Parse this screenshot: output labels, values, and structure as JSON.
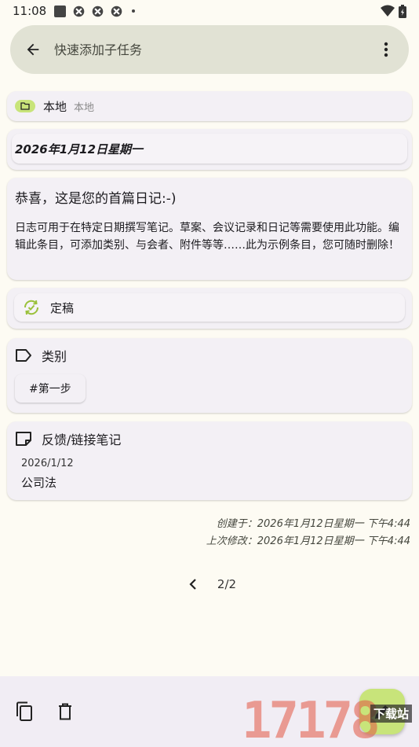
{
  "status_bar": {
    "time": "11:08"
  },
  "search": {
    "placeholder": "快速添加子任务"
  },
  "collection": {
    "name": "本地",
    "subtitle": "本地"
  },
  "entry": {
    "date": "2026年1月12日星期一",
    "title": "恭喜，这是您的首篇日记:-)",
    "description": "日志可用于在特定日期撰写笔记。草案、会议记录和日记等需要使用此功能。编辑此条目，可添加类别、与会者、附件等等……此为示例条目，您可随时删除！"
  },
  "status": {
    "label": "定稿"
  },
  "categories": {
    "header": "类别",
    "tags": [
      "#第一步"
    ]
  },
  "linked_notes": {
    "header": "反馈/链接笔记",
    "items": [
      {
        "date": "2026/1/12",
        "title": "公司法"
      }
    ]
  },
  "meta": {
    "created": "创建于：2026年1月12日星期一 下午4:44",
    "modified": "上次修改：2026年1月12日星期一 下午4:44"
  },
  "pager": {
    "text": "2/2"
  },
  "watermark": {
    "text": "17178",
    "sub": "下载站"
  },
  "colors": {
    "accent": "#c8e47a",
    "search_bg": "#e1e2d4",
    "card_bg": "#f3f0f5",
    "page_bg": "#fdfbf3"
  }
}
